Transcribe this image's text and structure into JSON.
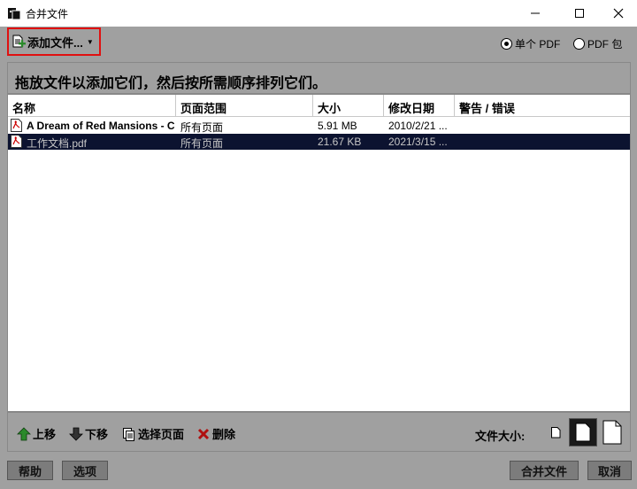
{
  "window": {
    "title": "合并文件"
  },
  "toolbar": {
    "add_files_label": "添加文件...",
    "radio_single_pdf": "单个 PDF",
    "radio_pdf_package": "PDF 包",
    "selected_mode": "单个 PDF"
  },
  "instruction": "拖放文件以添加它们，然后按所需顺序排列它们。",
  "table": {
    "columns": [
      "名称",
      "页面范围",
      "大小",
      "修改日期",
      "警告 / 错误"
    ],
    "rows": [
      {
        "name": "A Dream of Red Mansions - C...",
        "range": "所有页面",
        "size": "5.91 MB",
        "date": "2010/2/21 ...",
        "warning": "",
        "selected": false
      },
      {
        "name": "工作文档.pdf",
        "range": "所有页面",
        "size": "21.67 KB",
        "date": "2021/3/15 ...",
        "warning": "",
        "selected": true
      }
    ]
  },
  "actions": {
    "move_up": "上移",
    "move_down": "下移",
    "select_pages": "选择页面",
    "delete": "删除"
  },
  "file_size": {
    "label": "文件大小:",
    "selected": "medium"
  },
  "footer": {
    "help": "帮助",
    "options": "选项",
    "combine": "合并文件",
    "cancel": "取消"
  },
  "colors": {
    "accent_border": "#e01010",
    "selection_bg": "#0c1330",
    "panel_bg": "#a0a0a0"
  }
}
